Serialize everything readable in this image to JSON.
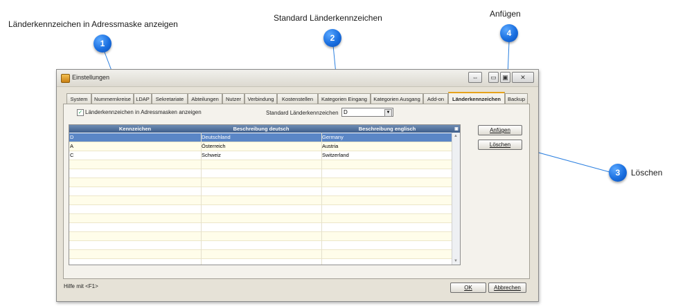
{
  "callouts": [
    {
      "num": "1",
      "label": "Länderkennzeichen in Adressmaske anzeigen"
    },
    {
      "num": "2",
      "label": "Standard Länderkennzeichen"
    },
    {
      "num": "3",
      "label": "Löschen"
    },
    {
      "num": "4",
      "label": "Anfügen"
    }
  ],
  "window": {
    "title": "Einstellungen"
  },
  "tabs": [
    "System",
    "Nummernkreise",
    "LDAP",
    "Sekretariate",
    "Abteilungen",
    "Nutzer",
    "Verbindung",
    "Kostenstellen",
    "Kategorien Eingang",
    "Kategorien Ausgang",
    "Add-on",
    "Länderkennzeichen",
    "Backup"
  ],
  "active_tab": "Länderkennzeichen",
  "show_in_address_mask": {
    "label": "Länderkennzeichen in Adressmasken anzeigen",
    "checked": true
  },
  "default_country": {
    "label": "Standard Länderkennzeichen",
    "value": "D"
  },
  "table": {
    "columns": [
      "Kennzeichen",
      "Beschreibung deutsch",
      "Beschreibung englisch"
    ],
    "rows": [
      [
        "D",
        "Deutschland",
        "Germany"
      ],
      [
        "A",
        "Österreich",
        "Austria"
      ],
      [
        "C",
        "Schweiz",
        "Switzerland"
      ]
    ]
  },
  "buttons": {
    "add": "Anfügen",
    "delete": "Löschen",
    "ok": "OK",
    "cancel": "Abbrechen"
  },
  "status": "Hilfe mit <F1>",
  "colors": {
    "badge": "#1a6fe0",
    "header": "#3e5e8b",
    "selected_row": "#5a86c6",
    "active_tab_accent": "#e6a21a"
  }
}
